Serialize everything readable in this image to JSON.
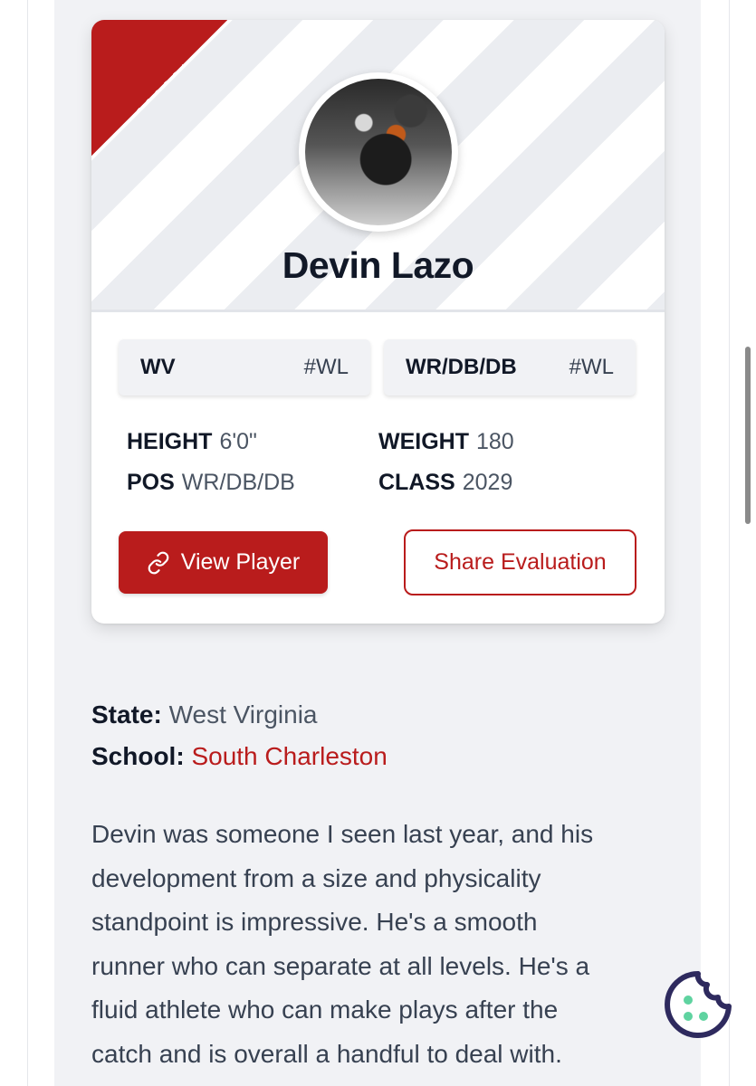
{
  "player": {
    "name": "Devin Lazo",
    "state_chip": {
      "value": "WV",
      "tag": "#WL"
    },
    "position_chip": {
      "value": "WR/DB/DB",
      "tag": "#WL"
    },
    "stats": {
      "height_label": "HEIGHT",
      "height_value": "6'0\"",
      "weight_label": "WEIGHT",
      "weight_value": "180",
      "pos_label": "POS",
      "pos_value": "WR/DB/DB",
      "class_label": "CLASS",
      "class_value": "2029"
    },
    "view_button_label": "View Player",
    "share_button_label": "Share Evaluation"
  },
  "details": {
    "state_label": "State:",
    "state_value": "West Virginia",
    "school_label": "School:",
    "school_value": "South Charleston"
  },
  "evaluation_lines": [
    "Devin was someone I seen last year, and his",
    "development from a size and physicality",
    "standpoint is impressive. He's a smooth",
    "runner who can separate at all levels. He's a",
    "fluid athlete who can make plays after the",
    "catch and is overall a handful to deal with."
  ],
  "colors": {
    "accent": "#b91c1c",
    "cookie_icon": "#2e2a5e",
    "cookie_dots": "#5fd3a0"
  },
  "icons": [
    "link-icon",
    "cookie-icon"
  ]
}
